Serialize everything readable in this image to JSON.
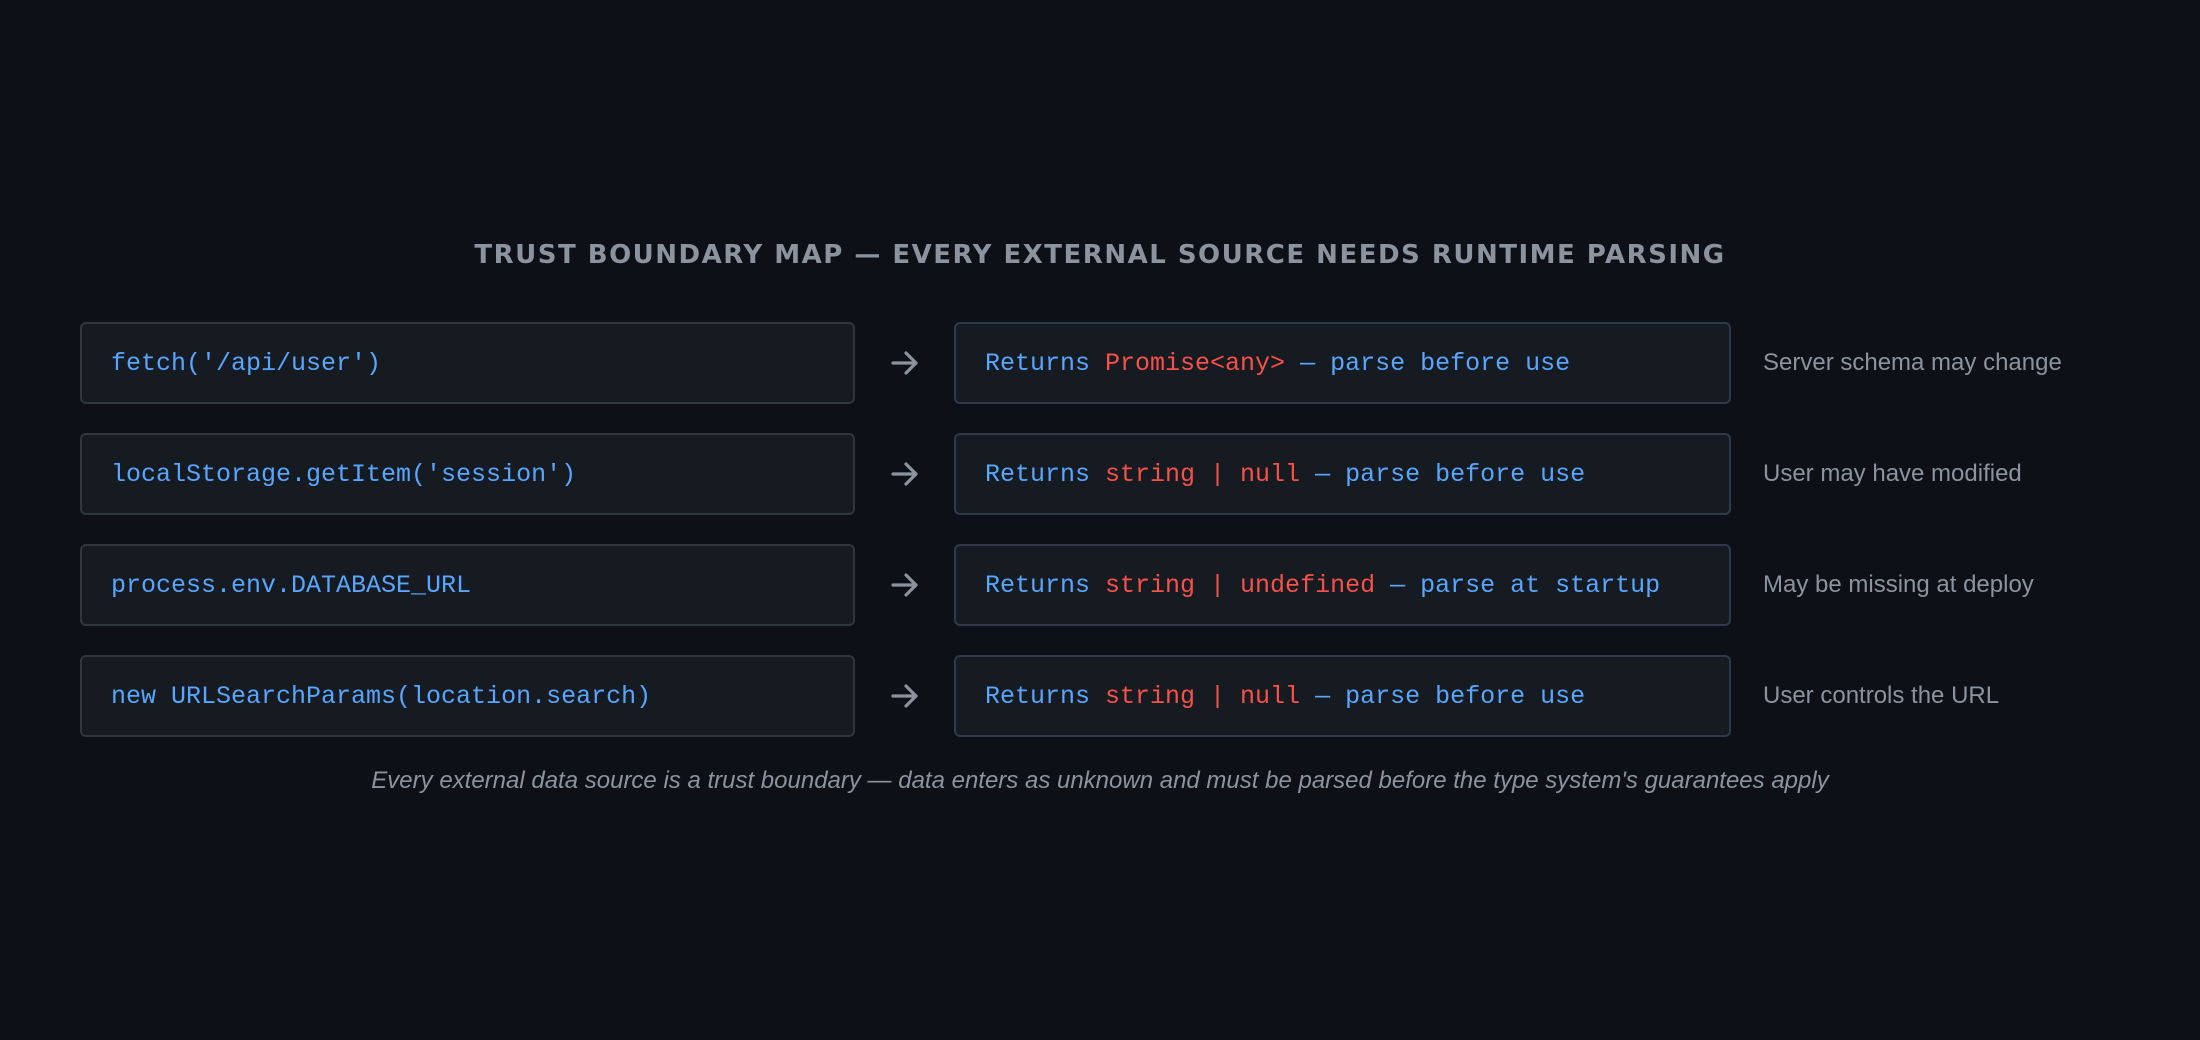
{
  "title": "TRUST BOUNDARY MAP — EVERY EXTERNAL SOURCE NEEDS RUNTIME PARSING",
  "rows": [
    {
      "source": "fetch('/api/user')",
      "result_prefix": "Returns ",
      "result_type": "Promise<any>",
      "result_suffix": " — parse before use",
      "note": "Server schema may change"
    },
    {
      "source": "localStorage.getItem('session')",
      "result_prefix": "Returns ",
      "result_type": "string | null",
      "result_suffix": " — parse before use",
      "note": "User may have modified"
    },
    {
      "source": "process.env.DATABASE_URL",
      "result_prefix": "Returns ",
      "result_type": "string | undefined",
      "result_suffix": " — parse at startup",
      "note": "May be missing at deploy"
    },
    {
      "source": "new URLSearchParams(location.search)",
      "result_prefix": "Returns ",
      "result_type": "string | null",
      "result_suffix": " — parse before use",
      "note": "User controls the URL"
    }
  ],
  "caption": "Every external data source is a trust boundary — data enters as unknown and must be parsed before the type system's guarantees apply",
  "colors": {
    "background": "#0d1117",
    "code_blue": "#58a6ff",
    "type_red": "#f85149",
    "muted_text": "#8b949e",
    "box_fill": "#161b22",
    "box_border": "#30363d"
  },
  "icons": {
    "connector": "arrow-right-icon"
  }
}
